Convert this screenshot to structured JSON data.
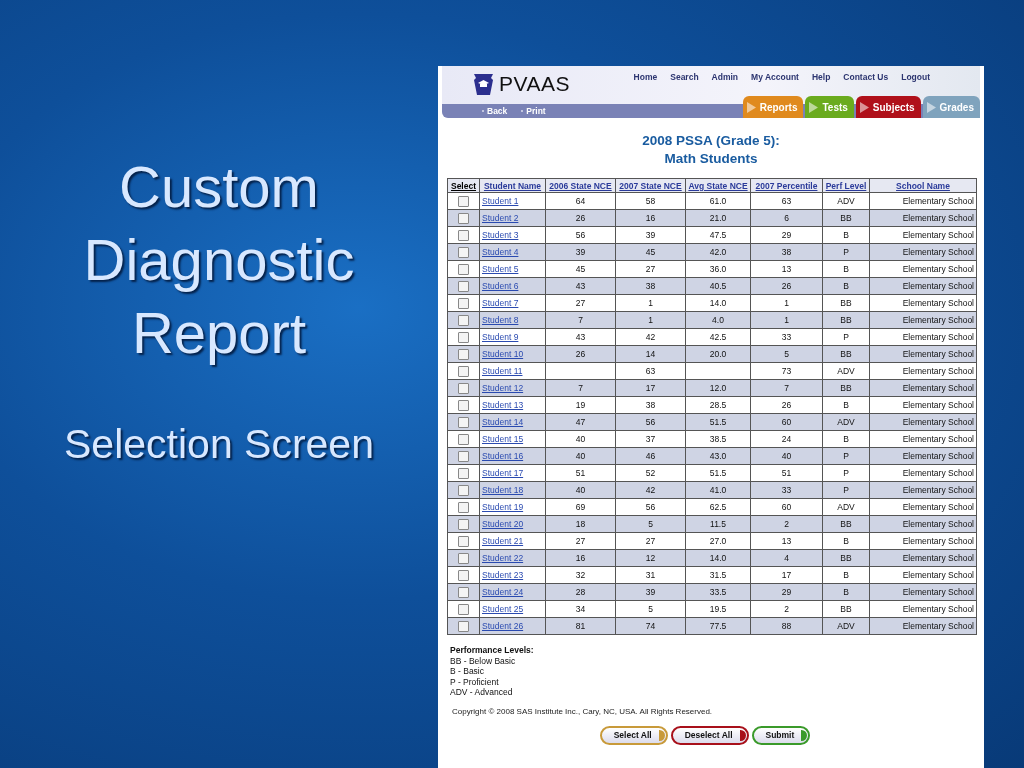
{
  "slide": {
    "title": "Custom Diagnostic Report",
    "subtitle": "Selection Screen"
  },
  "header": {
    "logo": "PVAAS",
    "nav": [
      "Home",
      "Search",
      "Admin",
      "My Account",
      "Help",
      "Contact Us",
      "Logout"
    ],
    "links": [
      "Back",
      "Print"
    ],
    "tabs": [
      {
        "label": "Reports",
        "color": "#e08a1e"
      },
      {
        "label": "Tests",
        "color": "#6aab1e"
      },
      {
        "label": "Subjects",
        "color": "#b0101a"
      },
      {
        "label": "Grades",
        "color": "#7fa3bd"
      }
    ]
  },
  "title": [
    "2008 PSSA (Grade 5):",
    "Math Students"
  ],
  "table": {
    "columns": [
      "Select",
      "Student Name",
      "2006 State NCE",
      "2007 State NCE",
      "Avg State NCE",
      "2007 Percentile",
      "Perf Level",
      "School Name"
    ],
    "rows": [
      {
        "checked": false,
        "cells": [
          "",
          "Student 1",
          "64",
          "58",
          "61.0",
          "63",
          "ADV",
          "Elementary School"
        ]
      },
      {
        "checked": false,
        "cells": [
          "",
          "Student 2",
          "26",
          "16",
          "21.0",
          "6",
          "BB",
          "Elementary School"
        ]
      },
      {
        "checked": false,
        "cells": [
          "",
          "Student 3",
          "56",
          "39",
          "47.5",
          "29",
          "B",
          "Elementary School"
        ]
      },
      {
        "checked": false,
        "cells": [
          "",
          "Student 4",
          "39",
          "45",
          "42.0",
          "38",
          "P",
          "Elementary School"
        ]
      },
      {
        "checked": false,
        "cells": [
          "",
          "Student 5",
          "45",
          "27",
          "36.0",
          "13",
          "B",
          "Elementary School"
        ]
      },
      {
        "checked": false,
        "cells": [
          "",
          "Student 6",
          "43",
          "38",
          "40.5",
          "26",
          "B",
          "Elementary School"
        ]
      },
      {
        "checked": false,
        "cells": [
          "",
          "Student 7",
          "27",
          "1",
          "14.0",
          "1",
          "BB",
          "Elementary School"
        ]
      },
      {
        "checked": false,
        "cells": [
          "",
          "Student 8",
          "7",
          "1",
          "4.0",
          "1",
          "BB",
          "Elementary School"
        ]
      },
      {
        "checked": false,
        "cells": [
          "",
          "Student 9",
          "43",
          "42",
          "42.5",
          "33",
          "P",
          "Elementary School"
        ]
      },
      {
        "checked": false,
        "cells": [
          "",
          "Student 10",
          "26",
          "14",
          "20.0",
          "5",
          "BB",
          "Elementary School"
        ]
      },
      {
        "checked": false,
        "cells": [
          "",
          "Student 11",
          null,
          "63",
          null,
          "73",
          "ADV",
          "Elementary School"
        ]
      },
      {
        "checked": false,
        "cells": [
          "",
          "Student 12",
          "7",
          "17",
          "12.0",
          "7",
          "BB",
          "Elementary School"
        ]
      },
      {
        "checked": false,
        "cells": [
          "",
          "Student 13",
          "19",
          "38",
          "28.5",
          "26",
          "B",
          "Elementary School"
        ]
      },
      {
        "checked": false,
        "cells": [
          "",
          "Student 14",
          "47",
          "56",
          "51.5",
          "60",
          "ADV",
          "Elementary School"
        ]
      },
      {
        "checked": false,
        "cells": [
          "",
          "Student 15",
          "40",
          "37",
          "38.5",
          "24",
          "B",
          "Elementary School"
        ]
      },
      {
        "checked": false,
        "cells": [
          "",
          "Student 16",
          "40",
          "46",
          "43.0",
          "40",
          "P",
          "Elementary School"
        ]
      },
      {
        "checked": false,
        "cells": [
          "",
          "Student 17",
          "51",
          "52",
          "51.5",
          "51",
          "P",
          "Elementary School"
        ]
      },
      {
        "checked": false,
        "cells": [
          "",
          "Student 18",
          "40",
          "42",
          "41.0",
          "33",
          "P",
          "Elementary School"
        ]
      },
      {
        "checked": false,
        "cells": [
          "",
          "Student 19",
          "69",
          "56",
          "62.5",
          "60",
          "ADV",
          "Elementary School"
        ]
      },
      {
        "checked": false,
        "cells": [
          "",
          "Student 20",
          "18",
          "5",
          "11.5",
          "2",
          "BB",
          "Elementary School"
        ]
      },
      {
        "checked": false,
        "cells": [
          "",
          "Student 21",
          "27",
          "27",
          "27.0",
          "13",
          "B",
          "Elementary School"
        ]
      },
      {
        "checked": false,
        "cells": [
          "",
          "Student 22",
          "16",
          "12",
          "14.0",
          "4",
          "BB",
          "Elementary School"
        ]
      },
      {
        "checked": false,
        "cells": [
          "",
          "Student 23",
          "32",
          "31",
          "31.5",
          "17",
          "B",
          "Elementary School"
        ]
      },
      {
        "checked": false,
        "cells": [
          "",
          "Student 24",
          "28",
          "39",
          "33.5",
          "29",
          "B",
          "Elementary School"
        ]
      },
      {
        "checked": false,
        "cells": [
          "",
          "Student 25",
          "34",
          "5",
          "19.5",
          "2",
          "BB",
          "Elementary School"
        ]
      },
      {
        "checked": false,
        "cells": [
          "",
          "Student 26",
          "81",
          "74",
          "77.5",
          "88",
          "ADV",
          "Elementary School"
        ]
      }
    ]
  },
  "legend": {
    "title": "Performance Levels:",
    "items": [
      "BB - Below Basic",
      "B - Basic",
      "P - Proficient",
      "ADV - Advanced"
    ]
  },
  "copyright": "Copyright © 2008 SAS Institute Inc., Cary, NC, USA. All Rights Reserved.",
  "buttons": [
    {
      "label": "Select All",
      "color": "#c89a3a"
    },
    {
      "label": "Deselect All",
      "color": "#a8101a"
    },
    {
      "label": "Submit",
      "color": "#3a9a2a"
    }
  ]
}
